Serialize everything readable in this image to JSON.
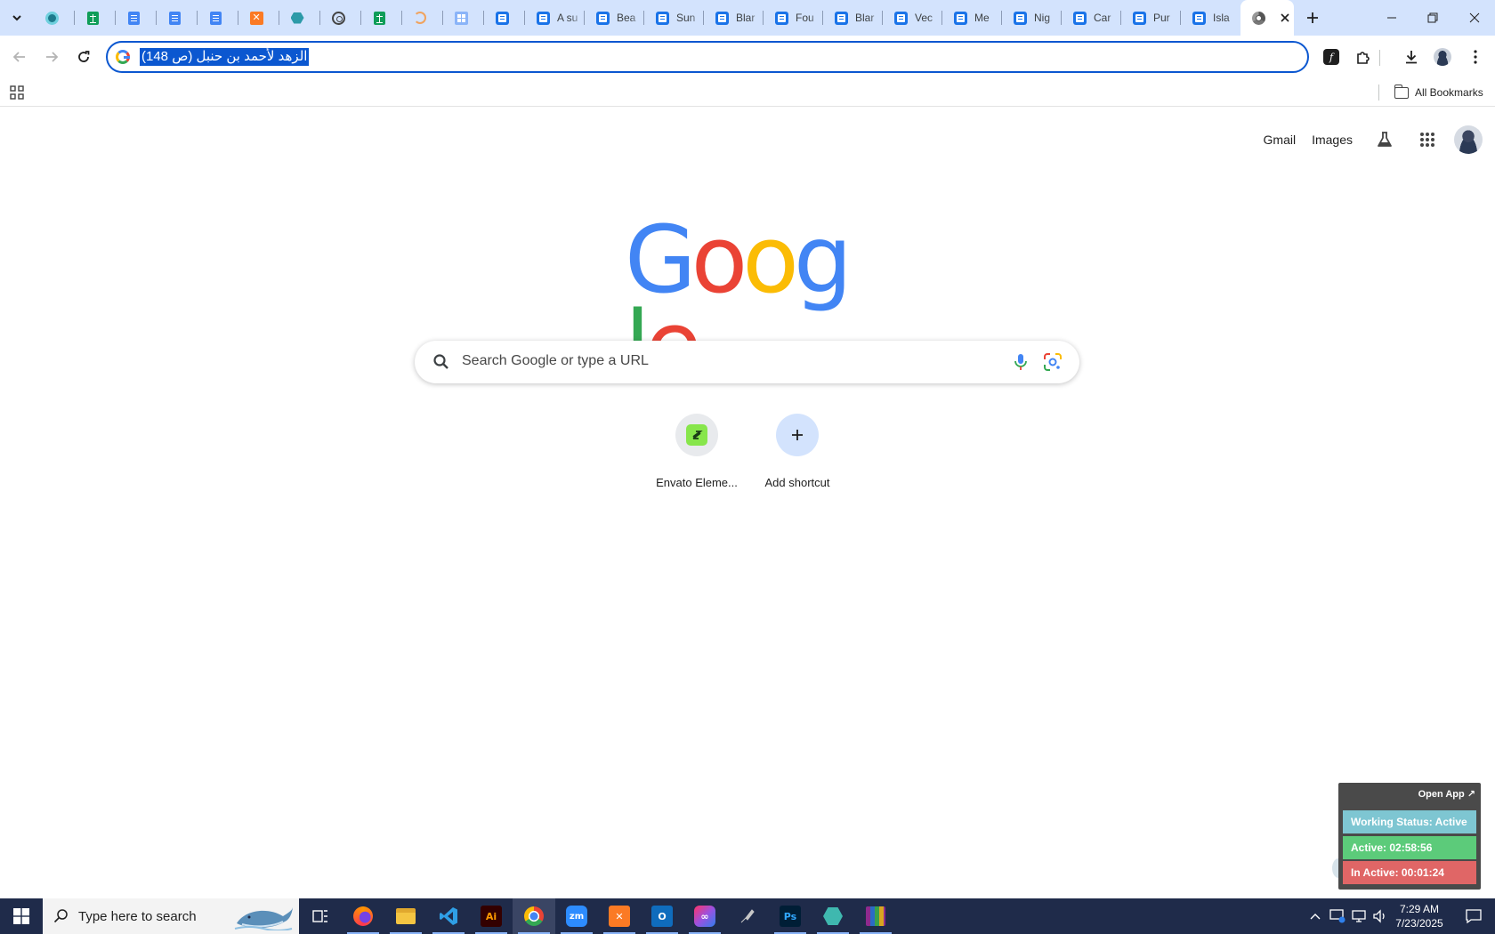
{
  "browser": {
    "tabs": [
      {
        "kind": "pinned",
        "icon": "vpn-shield-icon"
      },
      {
        "kind": "pinned",
        "icon": "google-sheets-icon"
      },
      {
        "kind": "pinned",
        "icon": "google-docs-icon"
      },
      {
        "kind": "pinned",
        "icon": "google-docs-icon"
      },
      {
        "kind": "pinned",
        "icon": "google-docs-icon"
      },
      {
        "kind": "pinned",
        "icon": "xampp-icon"
      },
      {
        "kind": "pinned",
        "icon": "teal-hexagon-icon"
      },
      {
        "kind": "pinned",
        "icon": "openai-icon"
      },
      {
        "kind": "pinned",
        "icon": "google-sheets-icon"
      },
      {
        "kind": "pinned",
        "icon": "orange-swirl-icon"
      },
      {
        "kind": "pinned",
        "icon": "grid-app-icon"
      },
      {
        "kind": "pinned",
        "icon": "google-forms-icon"
      },
      {
        "kind": "normal",
        "icon": "google-forms-icon",
        "title": "A su"
      },
      {
        "kind": "normal",
        "icon": "google-forms-icon",
        "title": "Bea"
      },
      {
        "kind": "normal",
        "icon": "google-forms-icon",
        "title": "Sun"
      },
      {
        "kind": "normal",
        "icon": "google-forms-icon",
        "title": "Blar"
      },
      {
        "kind": "normal",
        "icon": "google-forms-icon",
        "title": "Fou"
      },
      {
        "kind": "normal",
        "icon": "google-forms-icon",
        "title": "Blar"
      },
      {
        "kind": "normal",
        "icon": "google-forms-icon",
        "title": "Vec"
      },
      {
        "kind": "normal",
        "icon": "google-forms-icon",
        "title": "Me"
      },
      {
        "kind": "normal",
        "icon": "google-forms-icon",
        "title": "Nig"
      },
      {
        "kind": "normal",
        "icon": "google-forms-icon",
        "title": "Car"
      },
      {
        "kind": "normal",
        "icon": "google-forms-icon",
        "title": "Pur"
      },
      {
        "kind": "normal",
        "icon": "google-forms-icon",
        "title": "Isla"
      }
    ],
    "omnibox_text": "الزهد لأحمد بن حنبل (ص 148)",
    "all_bookmarks_label": "All Bookmarks"
  },
  "ntp": {
    "links": {
      "gmail": "Gmail",
      "images": "Images"
    },
    "logo": [
      "G",
      "o",
      "o",
      "g",
      "l",
      "e"
    ],
    "logo_colors": [
      "#4285f4",
      "#ea4335",
      "#fbbc05",
      "#4285f4",
      "#34a853",
      "#ea4335"
    ],
    "search_placeholder": "Search Google or type a URL",
    "shortcuts": [
      {
        "label": "Envato Eleme...",
        "icon": "envato-icon"
      },
      {
        "label": "Add shortcut",
        "icon": "plus-icon"
      }
    ]
  },
  "tracker": {
    "open_app": "Open App ↗",
    "working_status": "Working Status: Active",
    "active": "Active: 02:58:56",
    "inactive": "In Active: 00:01:24"
  },
  "taskbar": {
    "search_placeholder": "Type here to search",
    "apps": [
      "task-view-icon",
      "firefox-icon",
      "file-explorer-icon",
      "vscode-icon",
      "illustrator-icon",
      "chrome-icon",
      "zoom-icon",
      "xampp-icon",
      "outlook-icon",
      "creative-cloud-icon",
      "pen-tool-icon",
      "photoshop-icon",
      "teal-app-icon",
      "winrar-icon"
    ],
    "time": "7:29 AM",
    "date": "7/23/2025"
  }
}
